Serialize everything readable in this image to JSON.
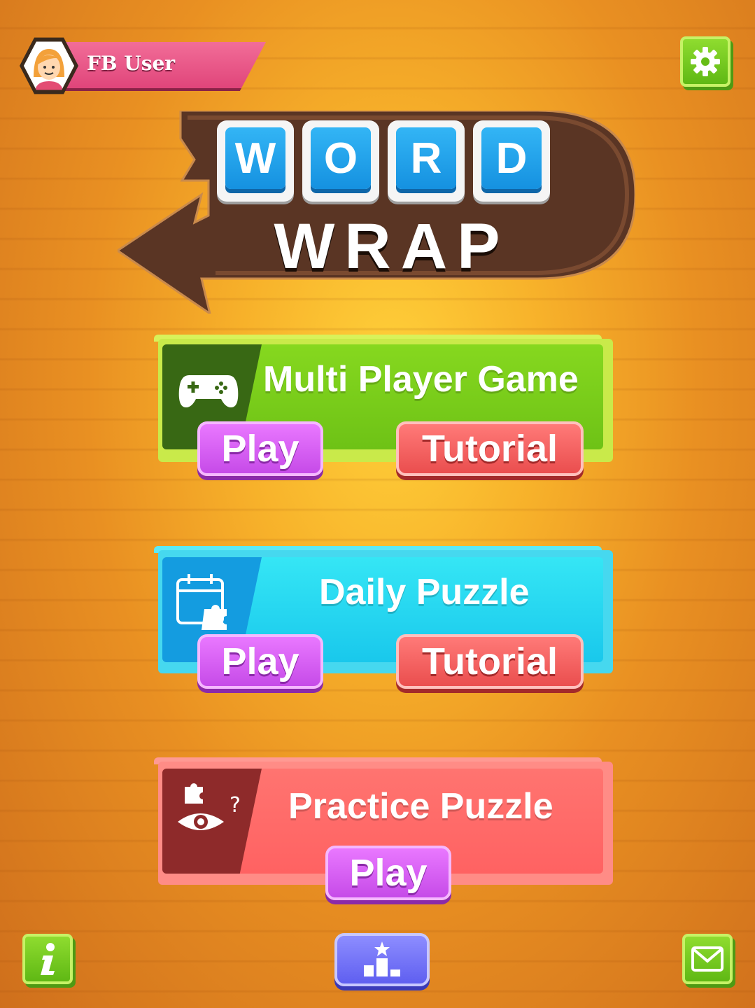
{
  "profile": {
    "name": "FB User"
  },
  "logo": {
    "letters": [
      "W",
      "O",
      "R",
      "D"
    ],
    "subtitle": "WRAP"
  },
  "modes": {
    "multiplayer": {
      "title": "Multi Player Game",
      "play_label": "Play",
      "tutorial_label": "Tutorial",
      "icon": "gamepad-icon",
      "color": "#7ccc1c"
    },
    "daily": {
      "title": "Daily Puzzle",
      "play_label": "Play",
      "tutorial_label": "Tutorial",
      "icon": "calendar-puzzle-icon",
      "color": "#2ad8f0"
    },
    "practice": {
      "title": "Practice Puzzle",
      "play_label": "Play",
      "icon": "puzzle-eye-icon",
      "color": "#ff6f6f"
    }
  },
  "toolbar": {
    "settings_icon": "gear-icon",
    "info_icon": "info-icon",
    "leaderboard_icon": "leaderboard-icon",
    "mail_icon": "mail-icon"
  }
}
